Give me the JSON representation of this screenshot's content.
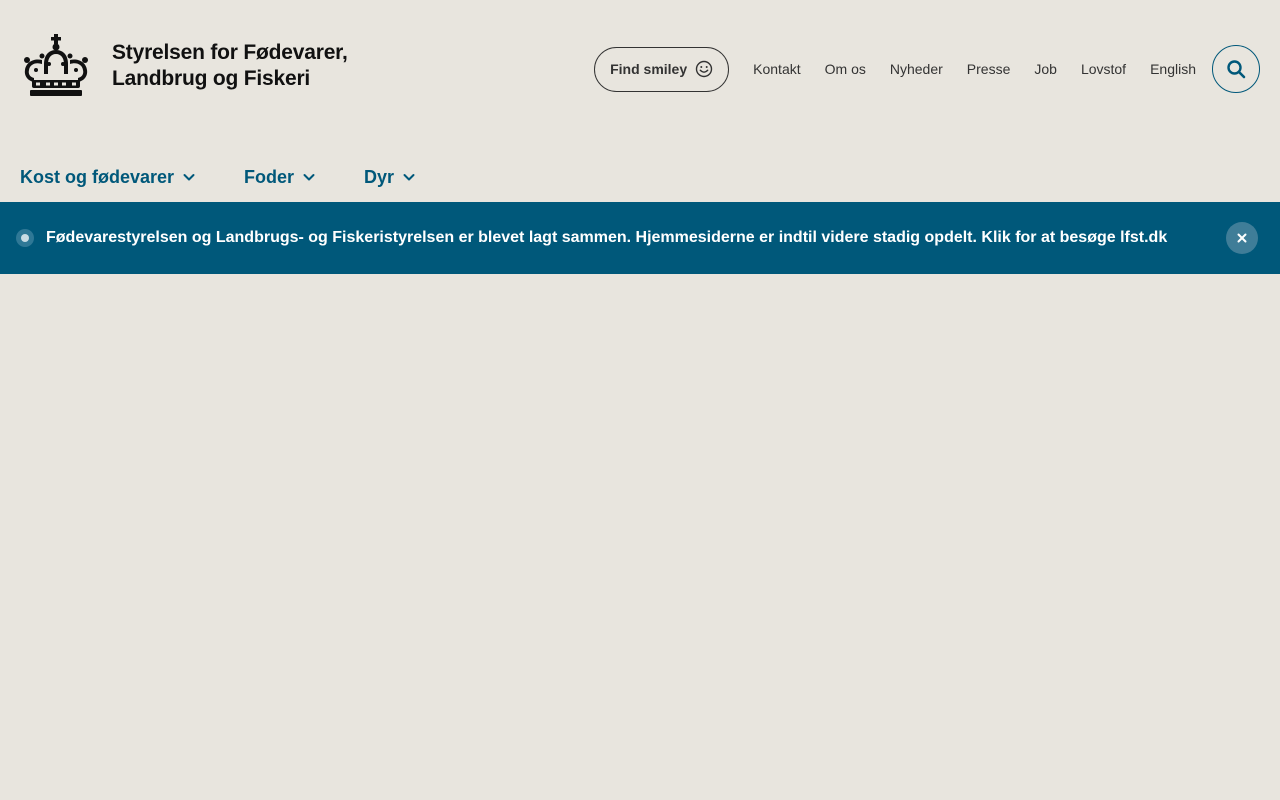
{
  "header": {
    "logo": {
      "line1": "Styrelsen for Fødevarer,",
      "line2": "Landbrug og Fiskeri",
      "icon": "crown-icon"
    },
    "find_smiley": {
      "label": "Find smiley",
      "icon": "smiley-icon"
    },
    "top_links": [
      {
        "label": "Kontakt"
      },
      {
        "label": "Om os"
      },
      {
        "label": "Nyheder"
      },
      {
        "label": "Presse"
      },
      {
        "label": "Job"
      },
      {
        "label": "Lovstof"
      },
      {
        "label": "English"
      }
    ],
    "search": {
      "icon": "search-icon"
    }
  },
  "main_nav": {
    "items": [
      {
        "label": "Kost og fødevarer",
        "icon": "chevron-down-icon"
      },
      {
        "label": "Foder",
        "icon": "chevron-down-icon"
      },
      {
        "label": "Dyr",
        "icon": "chevron-down-icon"
      }
    ]
  },
  "banner": {
    "text": "Fødevarestyrelsen og Landbrugs- og Fiskeristyrelsen er blevet lagt sammen. Hjemmesiderne er indtil videre stadig opdelt. Klik for at besøge lfst.dk",
    "close_icon": "close-icon"
  },
  "colors": {
    "background": "#e8e5de",
    "accent": "#00587a",
    "banner_bg": "#00587a",
    "text": "#333333"
  }
}
